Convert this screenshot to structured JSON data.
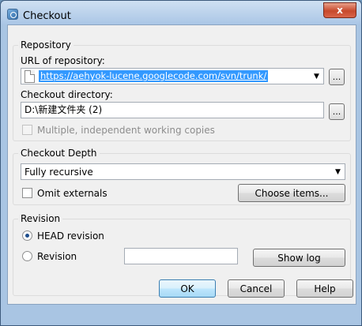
{
  "window": {
    "title": "Checkout",
    "close_glyph": "x"
  },
  "repository": {
    "group_label": "Repository",
    "url_label": "URL of repository:",
    "url_value": "https://aehyok-lucene.googlecode.com/svn/trunk/",
    "dir_label": "Checkout directory:",
    "dir_value": "D:\\新建文件夹 (2)",
    "browse_label": "...",
    "multiple_label": "Multiple, independent working copies"
  },
  "depth": {
    "group_label": "Checkout Depth",
    "selected": "Fully recursive",
    "omit_label": "Omit externals",
    "choose_label": "Choose items..."
  },
  "revision": {
    "group_label": "Revision",
    "head_label": "HEAD revision",
    "revision_label": "Revision",
    "revision_value": "",
    "showlog_label": "Show log"
  },
  "buttons": {
    "ok": "OK",
    "cancel": "Cancel",
    "help": "Help"
  },
  "icons": {
    "dropdown": "▼"
  }
}
